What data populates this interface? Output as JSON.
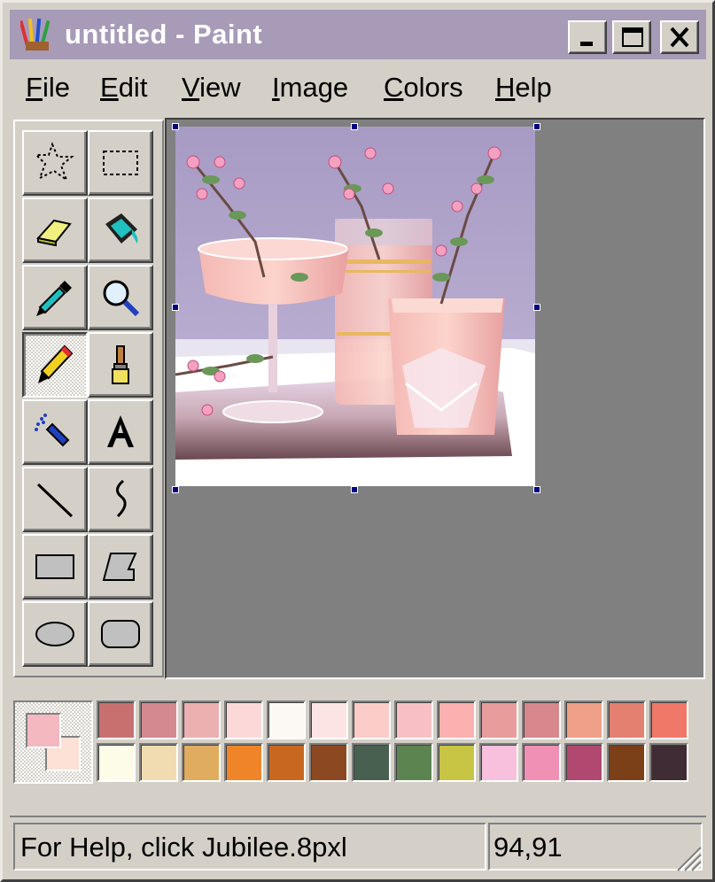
{
  "window": {
    "title": "untitled - Paint",
    "buttons": [
      "minimize",
      "maximize",
      "close"
    ]
  },
  "menubar": {
    "items": [
      {
        "label": "File",
        "accel": "F"
      },
      {
        "label": "Edit",
        "accel": "E"
      },
      {
        "label": "View",
        "accel": "V"
      },
      {
        "label": "Image",
        "accel": "I"
      },
      {
        "label": "Colors",
        "accel": "C"
      },
      {
        "label": "Help",
        "accel": "H"
      }
    ]
  },
  "toolbox": {
    "active_tool": "pencil",
    "tools": [
      "free-form-select",
      "select",
      "eraser",
      "fill-with-color",
      "pick-color",
      "magnifier",
      "pencil",
      "brush",
      "airbrush",
      "text",
      "line",
      "curve",
      "rectangle",
      "polygon",
      "ellipse",
      "rounded-rectangle"
    ]
  },
  "canvas": {
    "image": "glasses-with-blossom-branches"
  },
  "palette": {
    "foreground": "#f4b8c0",
    "background": "#fde0d6",
    "row1": [
      "#c87070",
      "#d48890",
      "#ecb0b0",
      "#fcd8d8",
      "#fcf8f4",
      "#fce4e4",
      "#fcccc8",
      "#f8c0c4",
      "#fcb0b0",
      "#e89c9c",
      "#d8888c",
      "#f0a088",
      "#e48070",
      "#f07868"
    ],
    "row2": [
      "#fcfce8",
      "#f0dcb0",
      "#e0ac60",
      "#f08428",
      "#c86820",
      "#8c4820",
      "#486050",
      "#5c8450",
      "#c8c444",
      "#f8c0dc",
      "#f090b4",
      "#b04870",
      "#7c4018",
      "#402c34"
    ]
  },
  "statusbar": {
    "help_text": "For Help, click Jubilee.8pxl",
    "coords": "94,91"
  }
}
